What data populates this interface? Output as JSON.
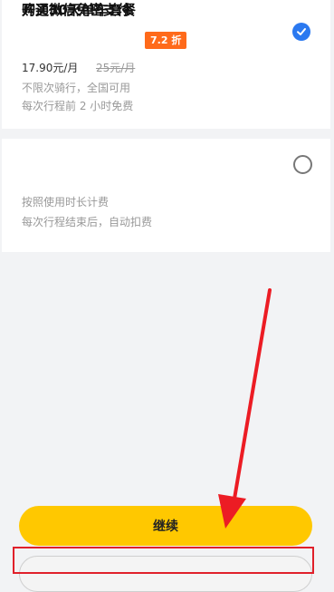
{
  "plan_card": {
    "title": "购买30天单车套餐",
    "discount_badge": "7.2 折",
    "price": "17.90元/月",
    "original_price": "25元/月",
    "desc_line1": "不限次骑行，全国可用",
    "desc_line2": "每次行程前 2 小时免费",
    "selected": true
  },
  "payment_card": {
    "title": "开通微信免密支付",
    "desc_line1": "按照使用时长计费",
    "desc_line2": "每次行程结束后，自动扣费",
    "selected": false
  },
  "buttons": {
    "continue_label": "继续"
  },
  "colors": {
    "accent_yellow": "#ffc800",
    "badge_orange": "#ff6a1a",
    "check_blue": "#2b79f0",
    "annotation_red": "#e0202a"
  }
}
